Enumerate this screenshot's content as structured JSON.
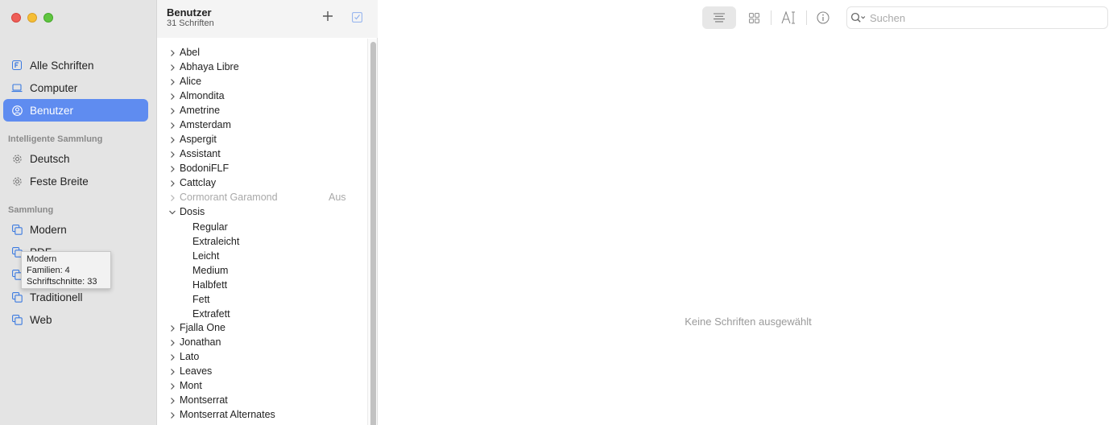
{
  "sidebar": {
    "library_items": [
      {
        "label": "Alle Schriften",
        "icon": "font-book-icon"
      },
      {
        "label": "Computer",
        "icon": "laptop-icon"
      },
      {
        "label": "Benutzer",
        "icon": "user-icon",
        "selected": true
      }
    ],
    "smart_section": "Intelligente Sammlung",
    "smart_items": [
      {
        "label": "Deutsch",
        "icon": "gear-icon"
      },
      {
        "label": "Feste Breite",
        "icon": "gear-icon"
      }
    ],
    "collection_section": "Sammlung",
    "collection_items": [
      {
        "label": "Modern",
        "icon": "collection-icon"
      },
      {
        "label": "PDF",
        "icon": "collection-icon"
      },
      {
        "label": "",
        "icon": "collection-icon"
      },
      {
        "label": "Traditionell",
        "icon": "collection-icon"
      },
      {
        "label": "Web",
        "icon": "collection-icon"
      }
    ],
    "tooltip": {
      "line1": "Modern",
      "line2": "Familien: 4",
      "line3": "Schriftschnitte: 33"
    }
  },
  "list": {
    "title": "Benutzer",
    "subtitle": "31 Schriften",
    "fonts": [
      {
        "name": "Abel"
      },
      {
        "name": "Abhaya Libre"
      },
      {
        "name": "Alice"
      },
      {
        "name": "Almondita"
      },
      {
        "name": "Ametrine"
      },
      {
        "name": "Amsterdam"
      },
      {
        "name": "Aspergit"
      },
      {
        "name": "Assistant"
      },
      {
        "name": "BodoniFLF"
      },
      {
        "name": "Cattclay"
      },
      {
        "name": "Cormorant Garamond",
        "disabled": true,
        "status": "Aus"
      },
      {
        "name": "Dosis",
        "expanded": true,
        "styles": [
          "Regular",
          "Extraleicht",
          "Leicht",
          "Medium",
          "Halbfett",
          "Fett",
          "Extrafett"
        ]
      },
      {
        "name": "Fjalla One"
      },
      {
        "name": "Jonathan"
      },
      {
        "name": "Lato"
      },
      {
        "name": "Leaves"
      },
      {
        "name": "Mont"
      },
      {
        "name": "Montserrat"
      },
      {
        "name": "Montserrat Alternates"
      }
    ]
  },
  "toolbar": {
    "search_placeholder": "Suchen"
  },
  "detail": {
    "empty_message": "Keine Schriften ausgewählt"
  },
  "colors": {
    "accent": "#5f8cf0",
    "sidebar_bg": "#e4e4e4"
  }
}
